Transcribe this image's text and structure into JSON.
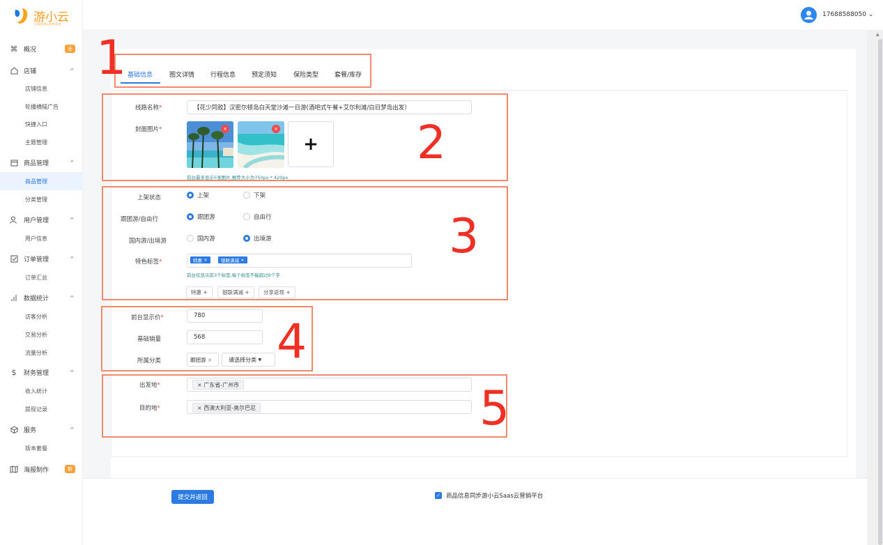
{
  "brand": {
    "name": "游小云",
    "tagline": "全域旅游云销售系统"
  },
  "header": {
    "phone": "17688588050",
    "dropdown_icon": "chevron-down-icon"
  },
  "sidebar": {
    "overview": {
      "label": "概况",
      "badge": "全"
    },
    "shop": {
      "label": "店铺",
      "items": [
        "店铺信息",
        "轮播横幅广告",
        "快捷入口",
        "主题管理"
      ]
    },
    "product": {
      "label": "商品管理",
      "items": [
        "商品管理",
        "分类管理"
      ]
    },
    "user": {
      "label": "用户管理",
      "items": [
        "用户信息"
      ]
    },
    "order": {
      "label": "订单管理",
      "items": [
        "订单汇总"
      ]
    },
    "stats": {
      "label": "数据统计",
      "items": [
        "访客分析",
        "交易分析",
        "流量分析"
      ]
    },
    "finance": {
      "label": "财务管理",
      "items": [
        "收入统计",
        "提现记录"
      ]
    },
    "service": {
      "label": "服务",
      "items": [
        "版本套餐"
      ]
    },
    "poster": {
      "label": "海报制作",
      "badge": "新"
    }
  },
  "tabs": [
    "基础信息",
    "图文详情",
    "行程信息",
    "预定须知",
    "保险类型",
    "套餐/库存"
  ],
  "annotations": [
    "1",
    "2",
    "3",
    "4",
    "5"
  ],
  "form": {
    "route_name": {
      "label": "线路名称",
      "value": "【花少同款】汉密尔顿岛白天堂沙滩一日游(酒吧式午餐+艾尔利滩/白日梦岛出发）"
    },
    "cover": {
      "label": "封面图片",
      "hint": "前台最多显示5张图片,推荐大小为750px * 420px"
    },
    "status": {
      "label": "上架状态",
      "options": [
        "上架",
        "下架"
      ],
      "selected": "上架"
    },
    "tour_type": {
      "label": "跟团游/自由行",
      "options": [
        "跟团游",
        "自由行"
      ],
      "selected": "跟团游"
    },
    "region": {
      "label": "国内游/出境游",
      "options": [
        "国内游",
        "出境游"
      ],
      "selected": "出境游"
    },
    "tags": {
      "label": "特色标签",
      "chips": [
        "特惠",
        "银联满减"
      ],
      "hint": "前台仅显示前3个标签,每个标签不能超过6个字",
      "quick": [
        "特惠",
        "银联满减",
        "分享返现"
      ]
    },
    "price": {
      "label": "前台显示价",
      "value": "780"
    },
    "sales": {
      "label": "基础销量",
      "value": "568"
    },
    "category": {
      "label": "所属分类",
      "tag": "跟团游",
      "placeholder": "请选择分类"
    },
    "departure": {
      "label": "出发地",
      "tag": "广东省-广州市"
    },
    "destination": {
      "label": "目的地",
      "tag": "西澳大利亚-奥尔巴尼"
    }
  },
  "footer": {
    "submit": "提交并返回",
    "sync_label": "商品信息同步游小云Saas云营销平台",
    "sync_checked": true
  }
}
